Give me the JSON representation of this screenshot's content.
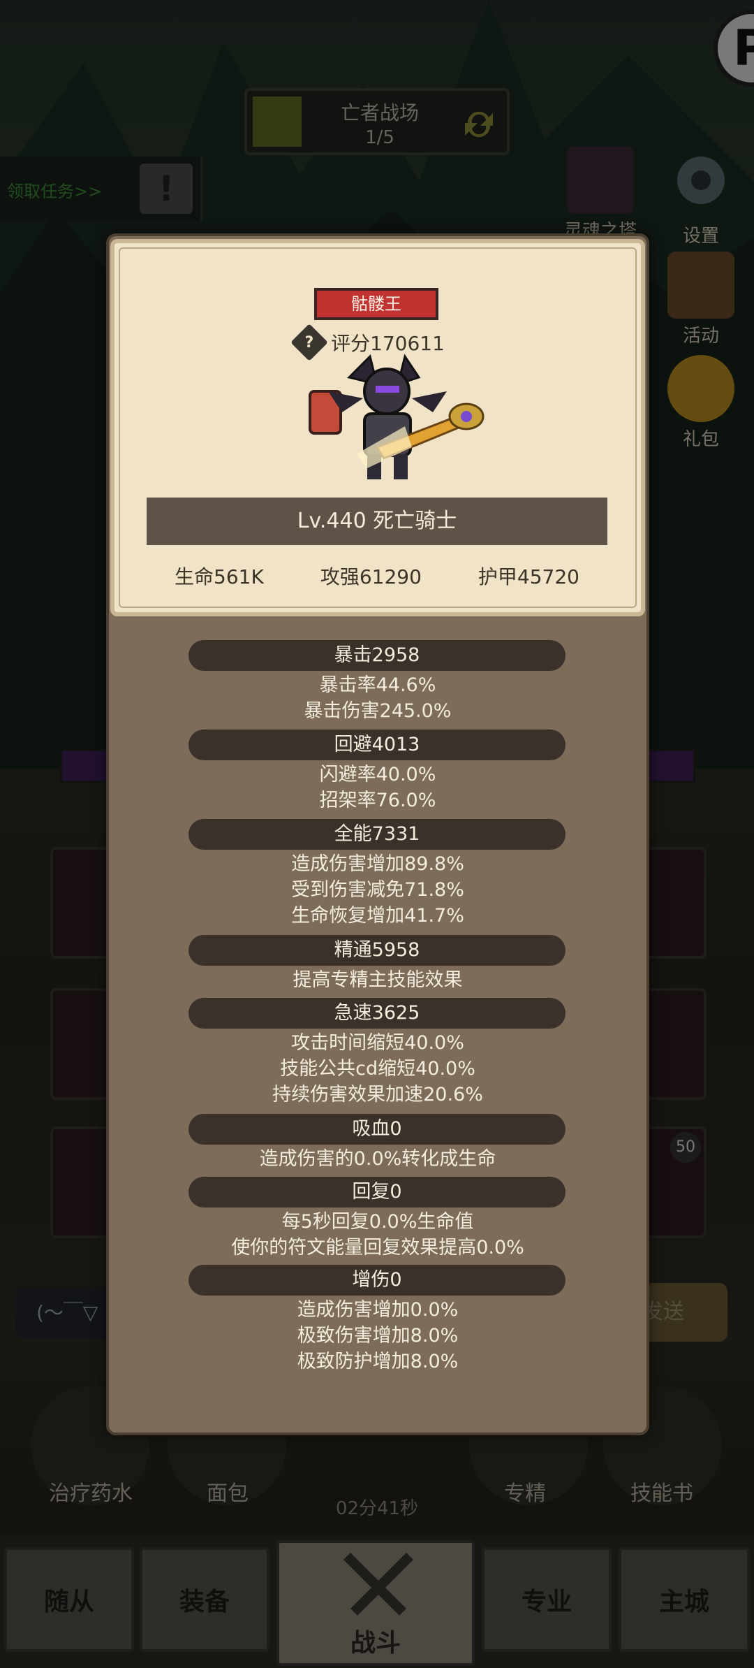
{
  "top_bar": {
    "title": "亡者战场",
    "progress": "1/5"
  },
  "quest": {
    "label": "领取任务>>",
    "alert": "!"
  },
  "logo": {
    "letter": "P"
  },
  "side_buttons": {
    "tower": "灵魂之塔",
    "settings": "设置",
    "events": "活动",
    "gift": "礼包"
  },
  "chat": {
    "placeholder": "(～￣▽",
    "send": "发送"
  },
  "consumables": [
    {
      "label": "治疗药水"
    },
    {
      "label": "面包"
    },
    {
      "label": "专精"
    },
    {
      "label": "技能书"
    }
  ],
  "timer": "02分41秒",
  "item_count": "50",
  "nav": {
    "followers": "随从",
    "equipment": "装备",
    "battle": "战斗",
    "profession": "专业",
    "main_city": "主城"
  },
  "boss": {
    "title": "骷髅王",
    "rating_label": "评分170611",
    "name": "Lv.440 死亡骑士",
    "hp": "生命561K",
    "attack": "攻强61290",
    "armor": "护甲45720"
  },
  "stats": [
    {
      "title": "暴击2958",
      "lines": [
        "暴击率44.6%",
        "暴击伤害245.0%"
      ]
    },
    {
      "title": "回避4013",
      "lines": [
        "闪避率40.0%",
        "招架率76.0%"
      ]
    },
    {
      "title": "全能7331",
      "lines": [
        "造成伤害增加89.8%",
        "受到伤害减免71.8%",
        "生命恢复增加41.7%"
      ]
    },
    {
      "title": "精通5958",
      "lines": [
        "提高专精主技能效果"
      ]
    },
    {
      "title": "急速3625",
      "lines": [
        "攻击时间缩短40.0%",
        "技能公共cd缩短40.0%",
        "持续伤害效果加速20.6%"
      ]
    },
    {
      "title": "吸血0",
      "lines": [
        "造成伤害的0.0%转化成生命"
      ]
    },
    {
      "title": "回复0",
      "lines": [
        "每5秒回复0.0%生命值",
        "使你的符文能量回复效果提高0.0%"
      ]
    },
    {
      "title": "增伤0",
      "lines": [
        "造成伤害增加0.0%",
        "极致伤害增加8.0%",
        "极致防护增加8.0%"
      ]
    }
  ],
  "colors": {
    "accent_red": "#c13331",
    "parchment": "#f0e3c8",
    "panel": "#7c6c59",
    "pill": "#3a322a"
  }
}
